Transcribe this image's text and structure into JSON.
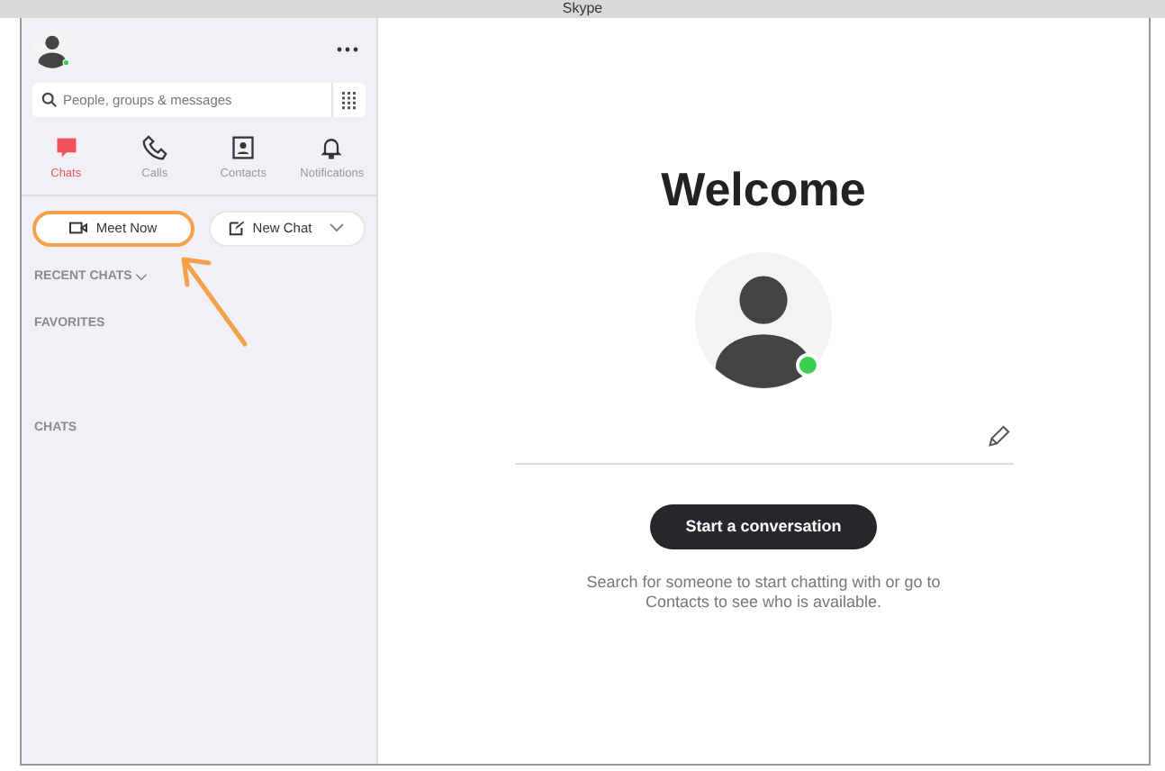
{
  "window": {
    "title": "Skype"
  },
  "sidebar": {
    "search": {
      "placeholder": "People, groups & messages"
    },
    "tabs": [
      {
        "kind": "chats",
        "label": "Chats",
        "selected": true
      },
      {
        "kind": "calls",
        "label": "Calls",
        "selected": false
      },
      {
        "kind": "contacts",
        "label": "Contacts",
        "selected": false
      },
      {
        "kind": "notifications",
        "label": "Notifications",
        "selected": false
      }
    ],
    "actions": [
      {
        "kind": "meet",
        "label": "Meet Now",
        "highlighted": true
      },
      {
        "kind": "new",
        "label": "New Chat",
        "highlighted": false
      }
    ],
    "sections": [
      {
        "label": "RECENT CHATS",
        "expandable": true
      },
      {
        "label": "FAVORITES",
        "expandable": false
      },
      {
        "label": "CHATS",
        "expandable": false
      }
    ]
  },
  "main": {
    "heading": "Welcome",
    "button": "Start a conversation",
    "hint": "Search for someone to start chatting with or go to Contacts to see who is available."
  }
}
